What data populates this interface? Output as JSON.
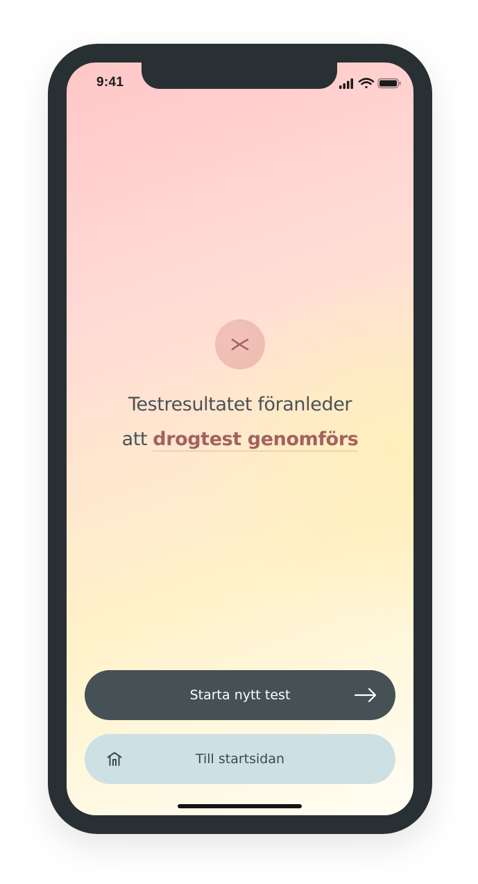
{
  "status_bar": {
    "time": "9:41",
    "icons": [
      "cellular-signal-icon",
      "wifi-icon",
      "battery-icon"
    ]
  },
  "result": {
    "icon": "close-icon",
    "headline_line1": "Testresultatet föranleder",
    "headline_line2_prefix": "att ",
    "headline_emphasis": "drogtest genomförs"
  },
  "actions": {
    "primary_label": "Starta nytt test",
    "primary_icon": "arrow-right-icon",
    "secondary_label": "Till startsidan",
    "secondary_icon": "home-icon"
  },
  "colors": {
    "frame": "#283033",
    "accent": "#a3625f",
    "primary_button": "#465156",
    "secondary_button": "#cde0e3"
  }
}
